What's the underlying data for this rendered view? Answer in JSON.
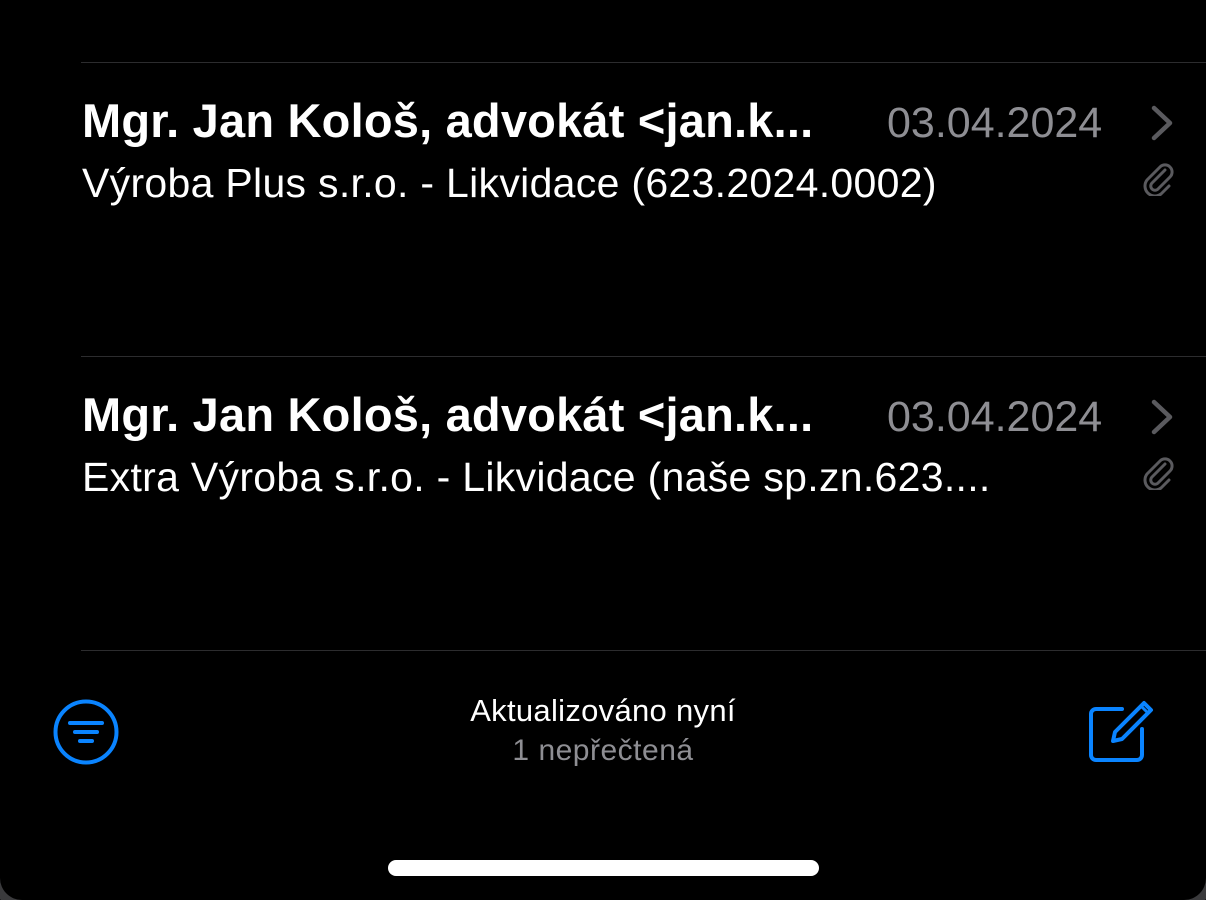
{
  "colors": {
    "background": "#000000",
    "accent": "#0a84ff",
    "secondary_text": "#8e8e93",
    "separator": "#2c2c2e"
  },
  "messages": [
    {
      "sender": "Mgr. Jan Kološ, advokát <jan.k...",
      "date": "03.04.2024",
      "subject": "Výroba Plus s.r.o. - Likvidace (623.2024.0002)",
      "has_attachment": true,
      "chevron_icon": "chevron-right-icon",
      "attachment_icon": "paperclip-icon"
    },
    {
      "sender": "Mgr. Jan Kološ, advokát <jan.k...",
      "date": "03.04.2024",
      "subject": "Extra Výroba s.r.o. - Likvidace (naše sp.zn.623....",
      "has_attachment": true,
      "chevron_icon": "chevron-right-icon",
      "attachment_icon": "paperclip-icon"
    }
  ],
  "toolbar": {
    "status": "Aktualizováno nyní",
    "unread": "1 nepřečtená",
    "filter_icon": "filter-icon",
    "compose_icon": "compose-icon"
  }
}
